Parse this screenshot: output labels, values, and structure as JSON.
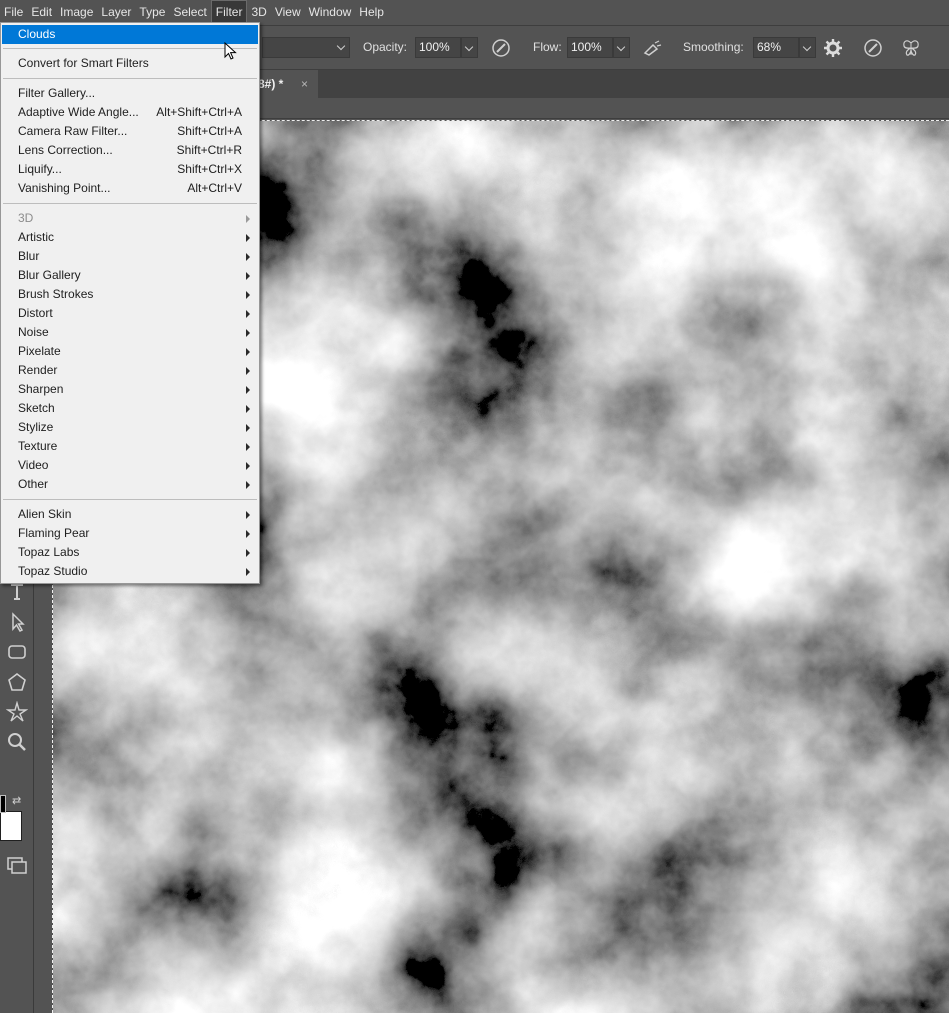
{
  "menubar": {
    "items": [
      "File",
      "Edit",
      "Image",
      "Layer",
      "Type",
      "Select",
      "Filter",
      "3D",
      "View",
      "Window",
      "Help"
    ],
    "active": "Filter"
  },
  "options": {
    "opacity_label": "Opacity:",
    "opacity_value": "100%",
    "flow_label": "Flow:",
    "flow_value": "100%",
    "smoothing_label": "Smoothing:",
    "smoothing_value": "68%"
  },
  "document_tab": {
    "title_fragment": "8#) *",
    "close": "×"
  },
  "filter_menu": {
    "last_filter": "Clouds",
    "convert_smart": "Convert for Smart Filters",
    "items_shortcuts": [
      {
        "label": "Filter Gallery...",
        "shortcut": ""
      },
      {
        "label": "Adaptive Wide Angle...",
        "shortcut": "Alt+Shift+Ctrl+A"
      },
      {
        "label": "Camera Raw Filter...",
        "shortcut": "Shift+Ctrl+A"
      },
      {
        "label": "Lens Correction...",
        "shortcut": "Shift+Ctrl+R"
      },
      {
        "label": "Liquify...",
        "shortcut": "Shift+Ctrl+X"
      },
      {
        "label": "Vanishing Point...",
        "shortcut": "Alt+Ctrl+V"
      }
    ],
    "submenus": [
      "3D",
      "Artistic",
      "Blur",
      "Blur Gallery",
      "Brush Strokes",
      "Distort",
      "Noise",
      "Pixelate",
      "Render",
      "Sharpen",
      "Sketch",
      "Stylize",
      "Texture",
      "Video",
      "Other"
    ],
    "plugins": [
      "Alien Skin",
      "Flaming Pear",
      "Topaz Labs",
      "Topaz Studio"
    ],
    "highlight_color": "#0078d7"
  },
  "colors": {
    "chrome": "#535353",
    "menu_bg": "#f0f0f0"
  }
}
